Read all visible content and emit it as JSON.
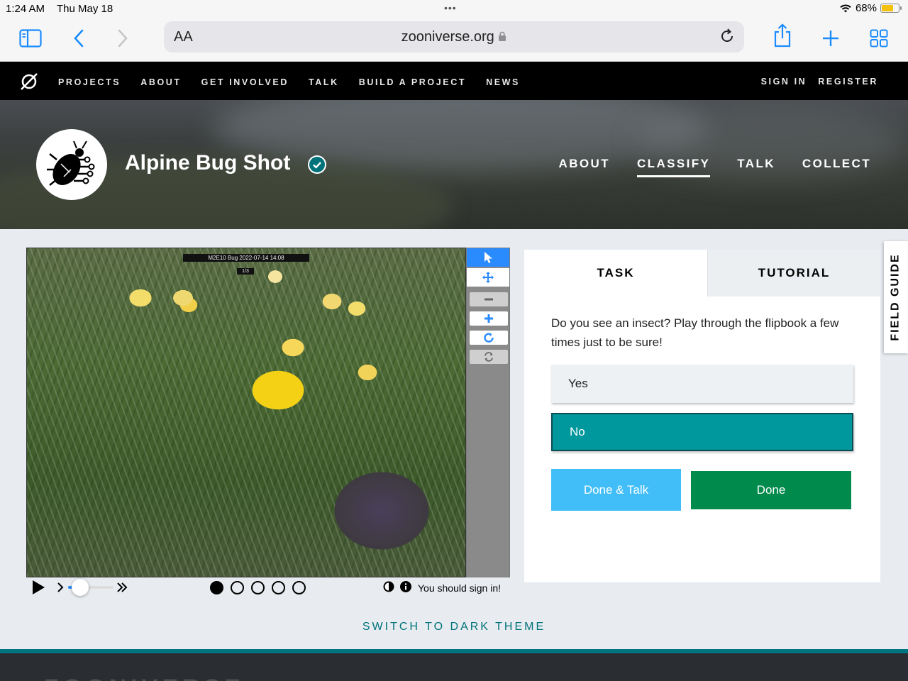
{
  "status_bar": {
    "time": "1:24 AM",
    "date": "Thu May 18",
    "battery": "68%",
    "battery_level": 0.68
  },
  "browser": {
    "text_size_label": "AA",
    "domain": "zooniverse.org"
  },
  "zoo_nav": {
    "links": [
      "PROJECTS",
      "ABOUT",
      "GET INVOLVED",
      "TALK",
      "BUILD A PROJECT",
      "NEWS"
    ],
    "sign_in": "SIGN IN",
    "register": "REGISTER"
  },
  "project": {
    "title": "Alpine Bug Shot",
    "nav": [
      "ABOUT",
      "CLASSIFY",
      "TALK",
      "COLLECT"
    ],
    "active_nav": "CLASSIFY"
  },
  "viewer": {
    "caption": "M2E10 Bug 2022-07-14 14:08",
    "caption2": "1/3",
    "frames": 5,
    "active_frame": 1,
    "sign_in_note": "You should sign in!"
  },
  "task": {
    "tabs": [
      "TASK",
      "TUTORIAL"
    ],
    "question": "Do you see an insect? Play through the flipbook a few times just to be sure!",
    "answers": [
      "Yes",
      "No"
    ],
    "selected_answer": "No",
    "done_talk_label": "Done & Talk",
    "done_label": "Done"
  },
  "field_guide_label": "FIELD GUIDE",
  "dark_theme_label": "SWITCH TO DARK THEME",
  "footer_text": "ZOONIVERSE",
  "colors": {
    "accent": "#00979d",
    "done": "#008a4c",
    "done_talk": "#41bdf8",
    "tool_active": "#2a8bff"
  }
}
